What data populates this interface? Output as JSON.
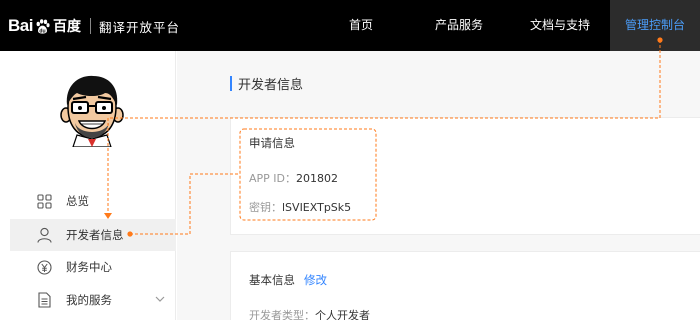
{
  "header": {
    "logo_latin_1": "Bai",
    "logo_latin_2": "du",
    "logo_cn": "百度",
    "logo_sub": "翻译开放平台",
    "nav": {
      "home": "首页",
      "products": "产品服务",
      "docs": "文档与支持",
      "console": "管理控制台"
    }
  },
  "sidebar": {
    "items": [
      {
        "label": "总览",
        "icon": "grid-icon"
      },
      {
        "label": "开发者信息",
        "icon": "user-icon"
      },
      {
        "label": "财务中心",
        "icon": "yen-icon"
      },
      {
        "label": "我的服务",
        "icon": "document-icon"
      }
    ]
  },
  "main": {
    "heading": "开发者信息",
    "apply_info": {
      "title": "申请信息",
      "app_id_label": "APP ID：",
      "app_id_value": "201802",
      "key_label": "密钥：",
      "key_value": "lSVIEXTpSk5"
    },
    "basic_info": {
      "title": "基本信息",
      "edit_label": "修改",
      "type_label": "开发者类型：",
      "type_value": "个人开发者"
    }
  },
  "colors": {
    "topbar_bg": "#000000",
    "console_active_text": "#4b9df9",
    "accent_blue": "#3385ff",
    "annotation_orange": "#ff7a1a"
  }
}
